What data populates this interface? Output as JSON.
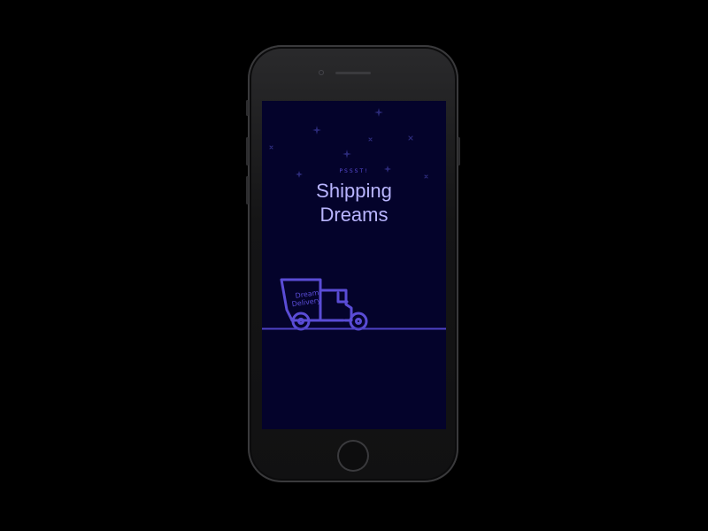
{
  "screen": {
    "eyebrow": "PSSST!",
    "title_line1": "Shipping",
    "title_line2": "Dreams",
    "truck_label_line1": "Dream",
    "truck_label_line2": "Delivery"
  },
  "icons": {
    "truck": "delivery-truck-icon",
    "stars": "sparkle-star-icon"
  },
  "colors": {
    "screen_background": "#04032b",
    "accent": "#5a4cd6",
    "title": "#b9b5ff",
    "phone_frame": "#1c1c1e"
  }
}
